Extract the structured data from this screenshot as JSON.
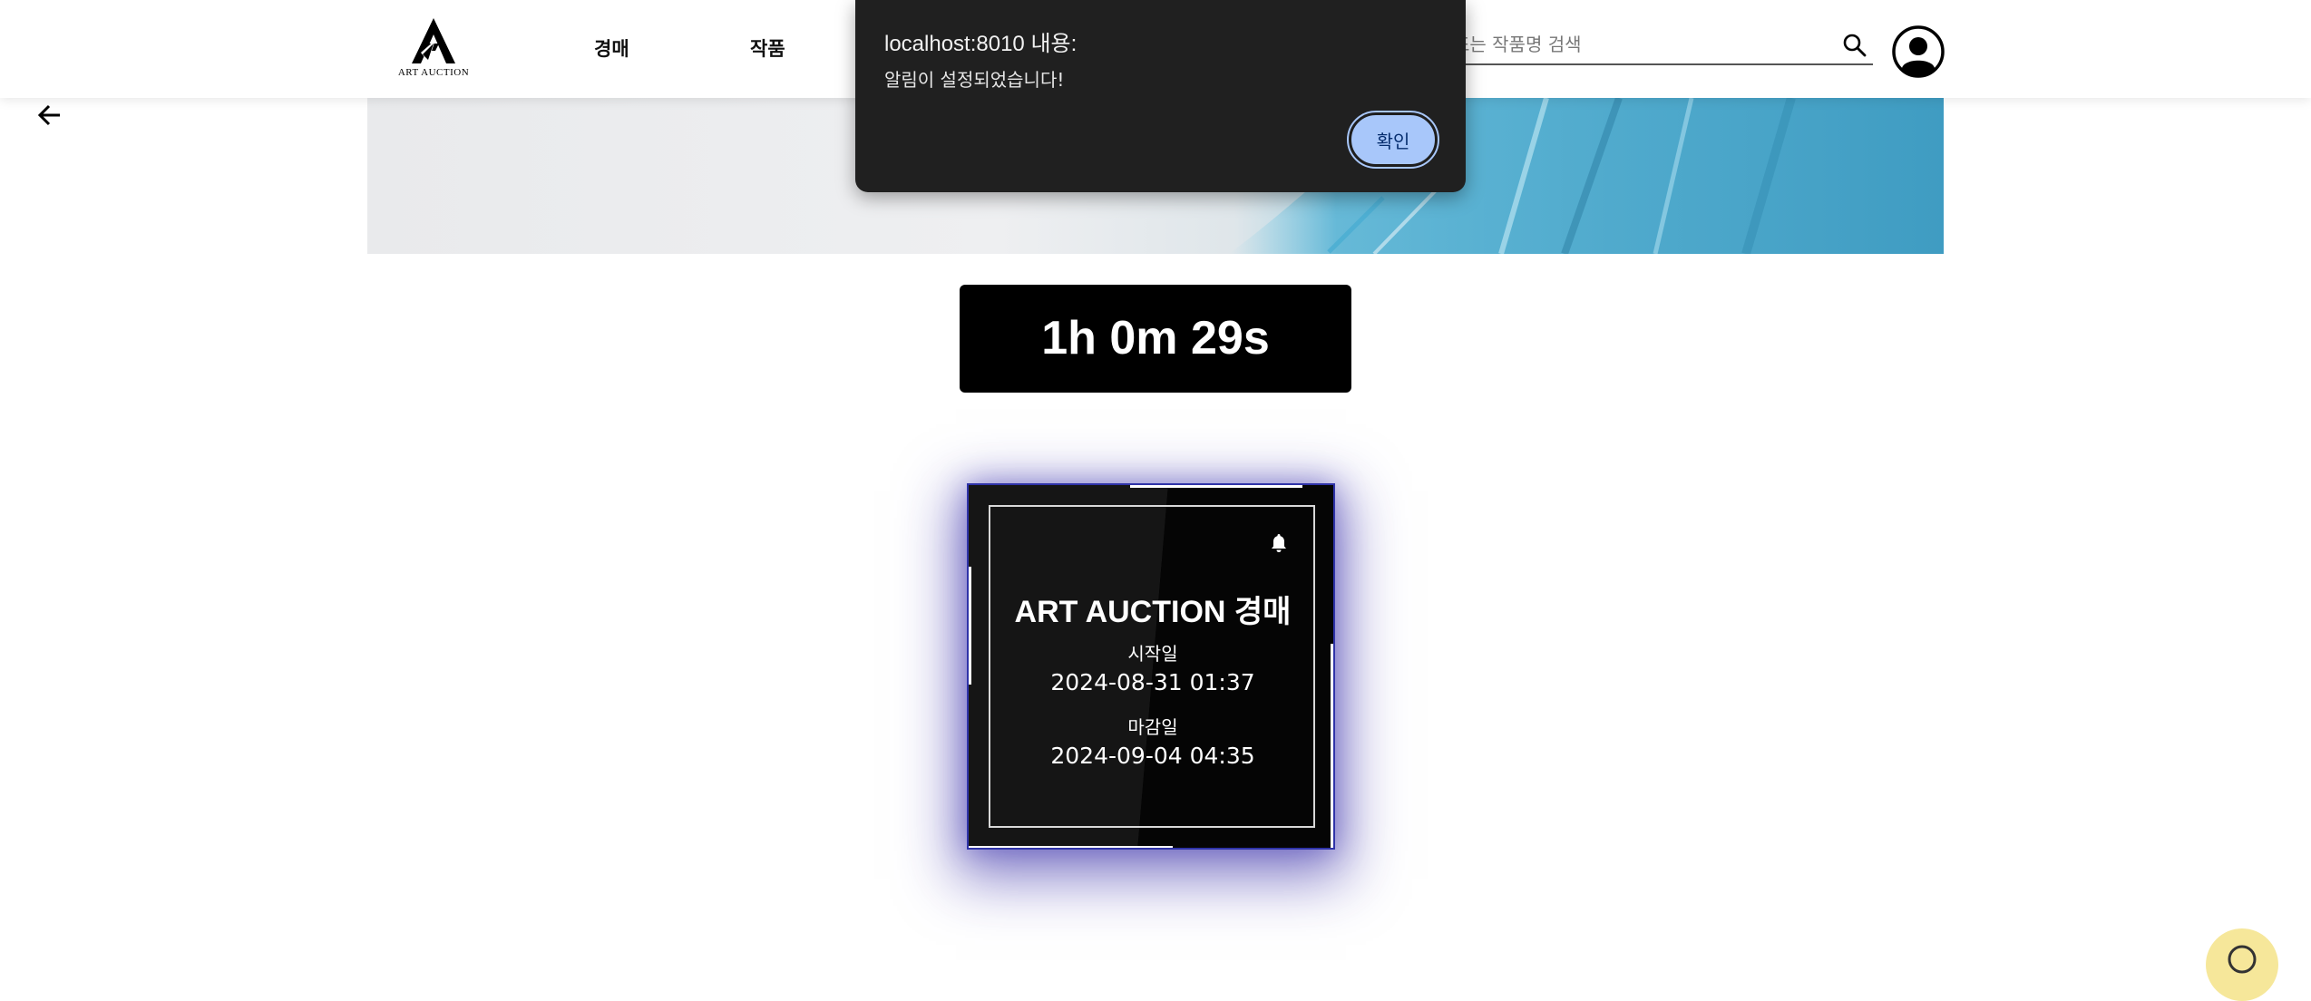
{
  "header": {
    "logo_text": "ART AUCTION",
    "nav": [
      {
        "label": "경매"
      },
      {
        "label": "작품"
      }
    ],
    "search": {
      "placeholder": "또는 작품명 검색"
    }
  },
  "countdown": {
    "text": "1h 0m 29s"
  },
  "card": {
    "title": "ART AUCTION 경매",
    "start_label": "시작일",
    "start_value": "2024-08-31 01:37",
    "end_label": "마감일",
    "end_value": "2024-09-04 04:35"
  },
  "dialog": {
    "title": "localhost:8010 내용:",
    "message": "알림이 설정되었습니다!",
    "ok_label": "확인"
  },
  "icons": {
    "logo": "art-auction-logo",
    "search": "search-icon",
    "avatar": "user-avatar-icon",
    "back": "arrow-left-icon",
    "bell": "bell-icon",
    "chat": "chat-icon"
  },
  "colors": {
    "dialog_bg": "#202020",
    "dialog_button": "#a8c7fa",
    "card_bg": "#000000",
    "card_border": "#2f33a8",
    "countdown_bg": "#000000"
  }
}
